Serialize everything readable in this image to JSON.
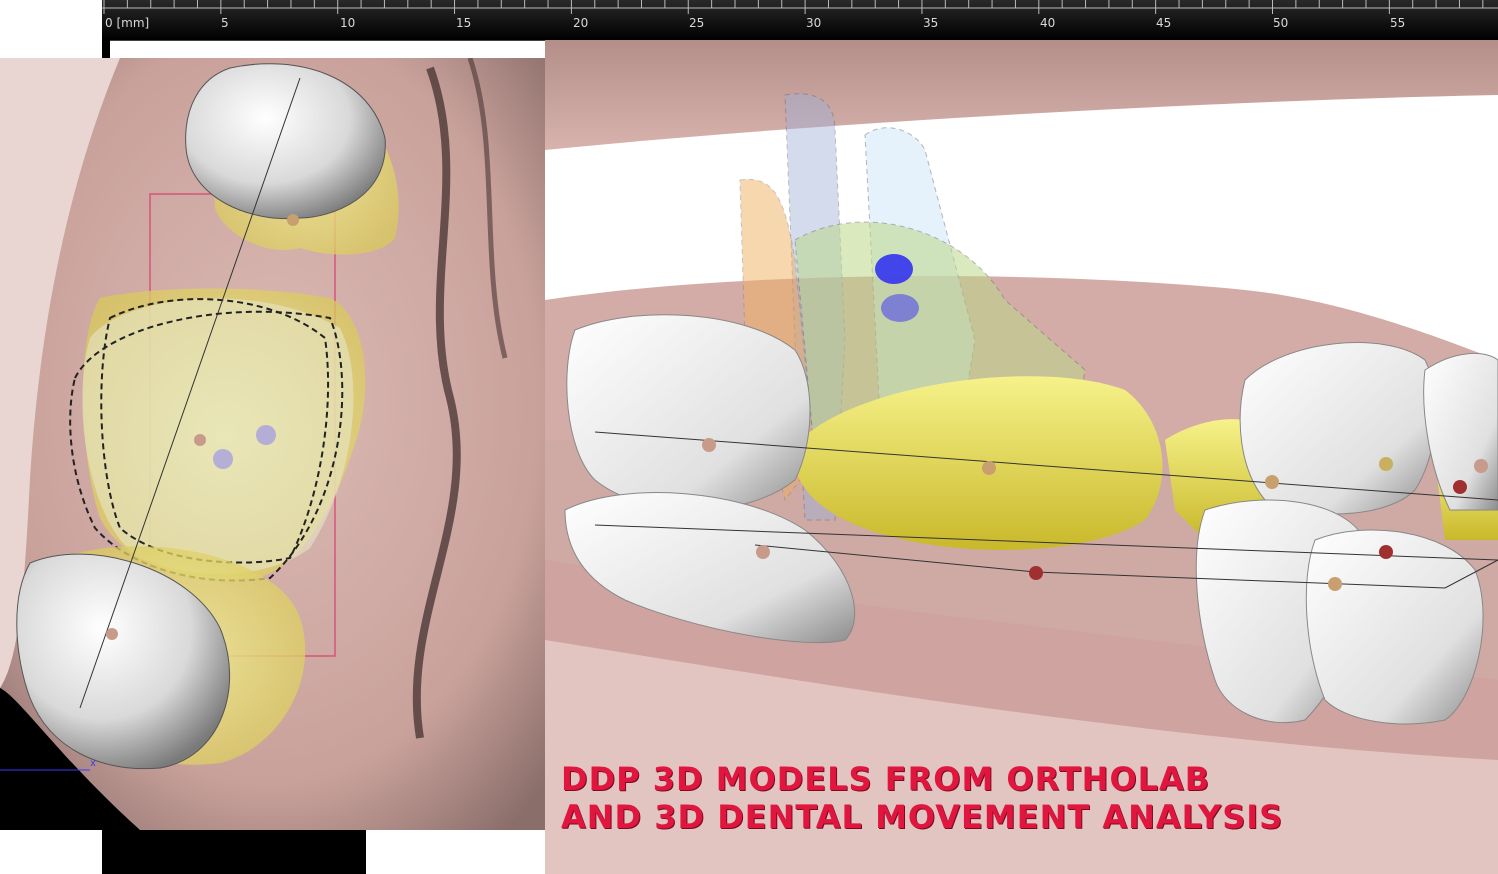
{
  "ruler": {
    "unit_label": "0 [mm]",
    "ticks": [
      "5",
      "10",
      "15",
      "20",
      "25",
      "30",
      "35",
      "40",
      "45",
      "50",
      "55"
    ]
  },
  "caption": {
    "line1": "DDP 3D MODELS FROM ORTHOLAB",
    "line2": "AND 3D DENTAL MOVEMENT ANALYSIS"
  },
  "axis": {
    "x_label": "x"
  },
  "colors": {
    "gingiva": "#cfa9a4",
    "tooth": "#e6e6e6",
    "overlay_yellow": "#e6e040",
    "caption": "#e0163f",
    "marker_blue": "#3333ee"
  },
  "icons": [
    "landmark-marker",
    "root-outline"
  ]
}
